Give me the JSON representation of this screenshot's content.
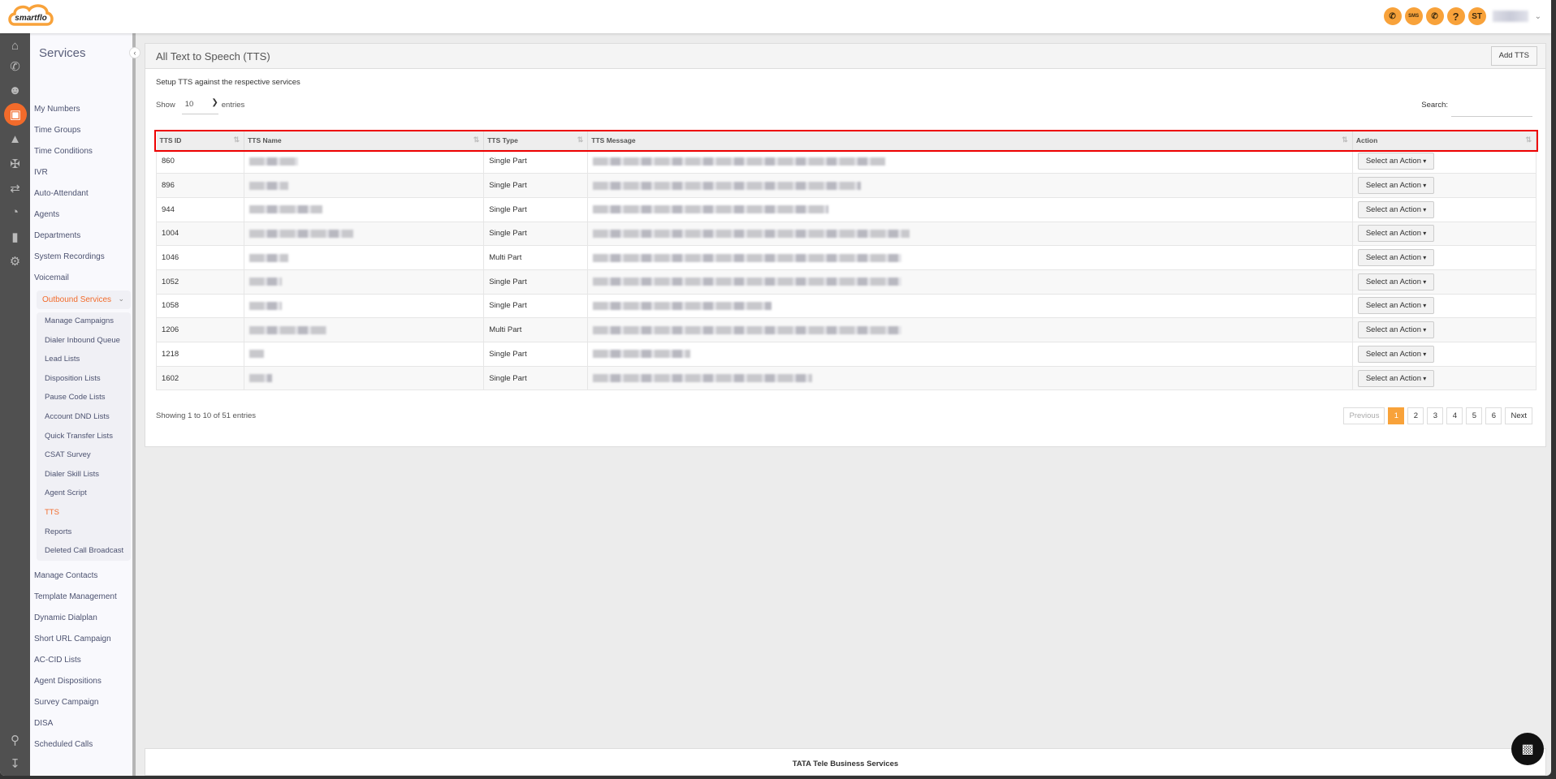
{
  "app": {
    "brand": "smartflo",
    "accent": "#f26b2b",
    "header_icon_color": "#f8a23a"
  },
  "topbar": {
    "icons": [
      "call-icon",
      "sms-icon",
      "call-timer-icon",
      "help-icon"
    ],
    "sms_label": "SMS",
    "help_label": "?",
    "avatar_initials": "ST"
  },
  "rail": {
    "icons": [
      "home-icon",
      "phone-icon",
      "users-icon",
      "services-icon",
      "network-icon",
      "integrations-icon",
      "routing-icon",
      "pie-chart-icon",
      "bar-chart-icon",
      "gear-icon",
      "search-icon",
      "download-icon"
    ],
    "active": "services-icon"
  },
  "sidebar": {
    "title": "Services",
    "items_top": [
      "My Numbers",
      "Time Groups",
      "Time Conditions",
      "IVR",
      "Auto-Attendant",
      "Agents",
      "Departments",
      "System Recordings",
      "Voicemail"
    ],
    "expanded": "Outbound Services",
    "sub_items": [
      "Manage Campaigns",
      "Dialer Inbound Queue",
      "Lead Lists",
      "Disposition Lists",
      "Pause Code Lists",
      "Account DND Lists",
      "Quick Transfer Lists",
      "CSAT Survey",
      "Dialer Skill Lists",
      "Agent Script",
      "TTS",
      "Reports",
      "Deleted Call Broadcast"
    ],
    "active_sub": "TTS",
    "items_bottom": [
      "Manage Contacts",
      "Template Management",
      "Dynamic Dialplan",
      "Short URL Campaign",
      "AC-CID Lists",
      "Agent Dispositions",
      "Survey Campaign",
      "DISA",
      "Scheduled Calls"
    ]
  },
  "panel": {
    "title": "All Text to Speech (TTS)",
    "add_button": "Add TTS",
    "subtitle": "Setup TTS against the respective services",
    "show_label": "Show",
    "entries_value": "10",
    "entries_label": "entries",
    "search_label": "Search:",
    "columns": [
      "TTS ID",
      "TTS Name",
      "TTS Type",
      "TTS Message",
      "Action"
    ],
    "rows": [
      {
        "id": "860",
        "type": "Single Part"
      },
      {
        "id": "896",
        "type": "Single Part"
      },
      {
        "id": "944",
        "type": "Single Part"
      },
      {
        "id": "1004",
        "type": "Single Part"
      },
      {
        "id": "1046",
        "type": "Multi Part"
      },
      {
        "id": "1052",
        "type": "Single Part"
      },
      {
        "id": "1058",
        "type": "Single Part"
      },
      {
        "id": "1206",
        "type": "Multi Part"
      },
      {
        "id": "1218",
        "type": "Single Part"
      },
      {
        "id": "1602",
        "type": "Single Part"
      }
    ],
    "action_label": "Select an Action",
    "info": "Showing 1 to 10 of 51 entries",
    "pagination": {
      "previous": "Previous",
      "pages": [
        "1",
        "2",
        "3",
        "4",
        "5",
        "6"
      ],
      "current": "1",
      "next": "Next"
    }
  },
  "footer": {
    "text": "TATA Tele Business Services"
  }
}
